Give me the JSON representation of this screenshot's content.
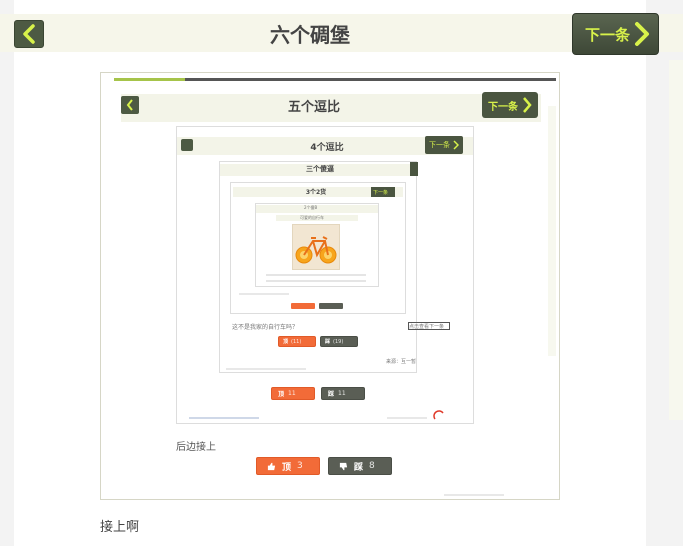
{
  "header": {
    "title": "六个碉堡",
    "next_label": "下一条"
  },
  "screenshot": {
    "level2": {
      "title": "五个逗比",
      "next_label": "下一条",
      "progress": 0.16
    },
    "level3": {
      "title": "4个逗比",
      "next_label": "下一条",
      "caption": "后边接上",
      "up_label": "顶",
      "up_count": "3",
      "down_label": "踩",
      "down_count": "8"
    },
    "level4": {
      "title": "三个傻逼",
      "up_label": "顶",
      "up_count": "11",
      "down_label": "踩",
      "down_count": "11"
    },
    "level5": {
      "title": "3个2货",
      "next_label": "下一条",
      "caption": "这不是我家的自行车吗？",
      "up_label": "顶",
      "up_count": "(11)",
      "down_label": "踩",
      "down_count": "(19)",
      "source": "来源：互一暂",
      "side_label": "点击查看下一条"
    },
    "level6": {
      "title": "2个傻B",
      "sub": "可爱的自行车"
    }
  },
  "footer": {
    "text": "接上啊"
  },
  "colors": {
    "accent_green": "#d8f24a",
    "dark_olive": "#4d5a43",
    "vote_up": "#f26b38",
    "vote_down": "#5a5e55"
  }
}
